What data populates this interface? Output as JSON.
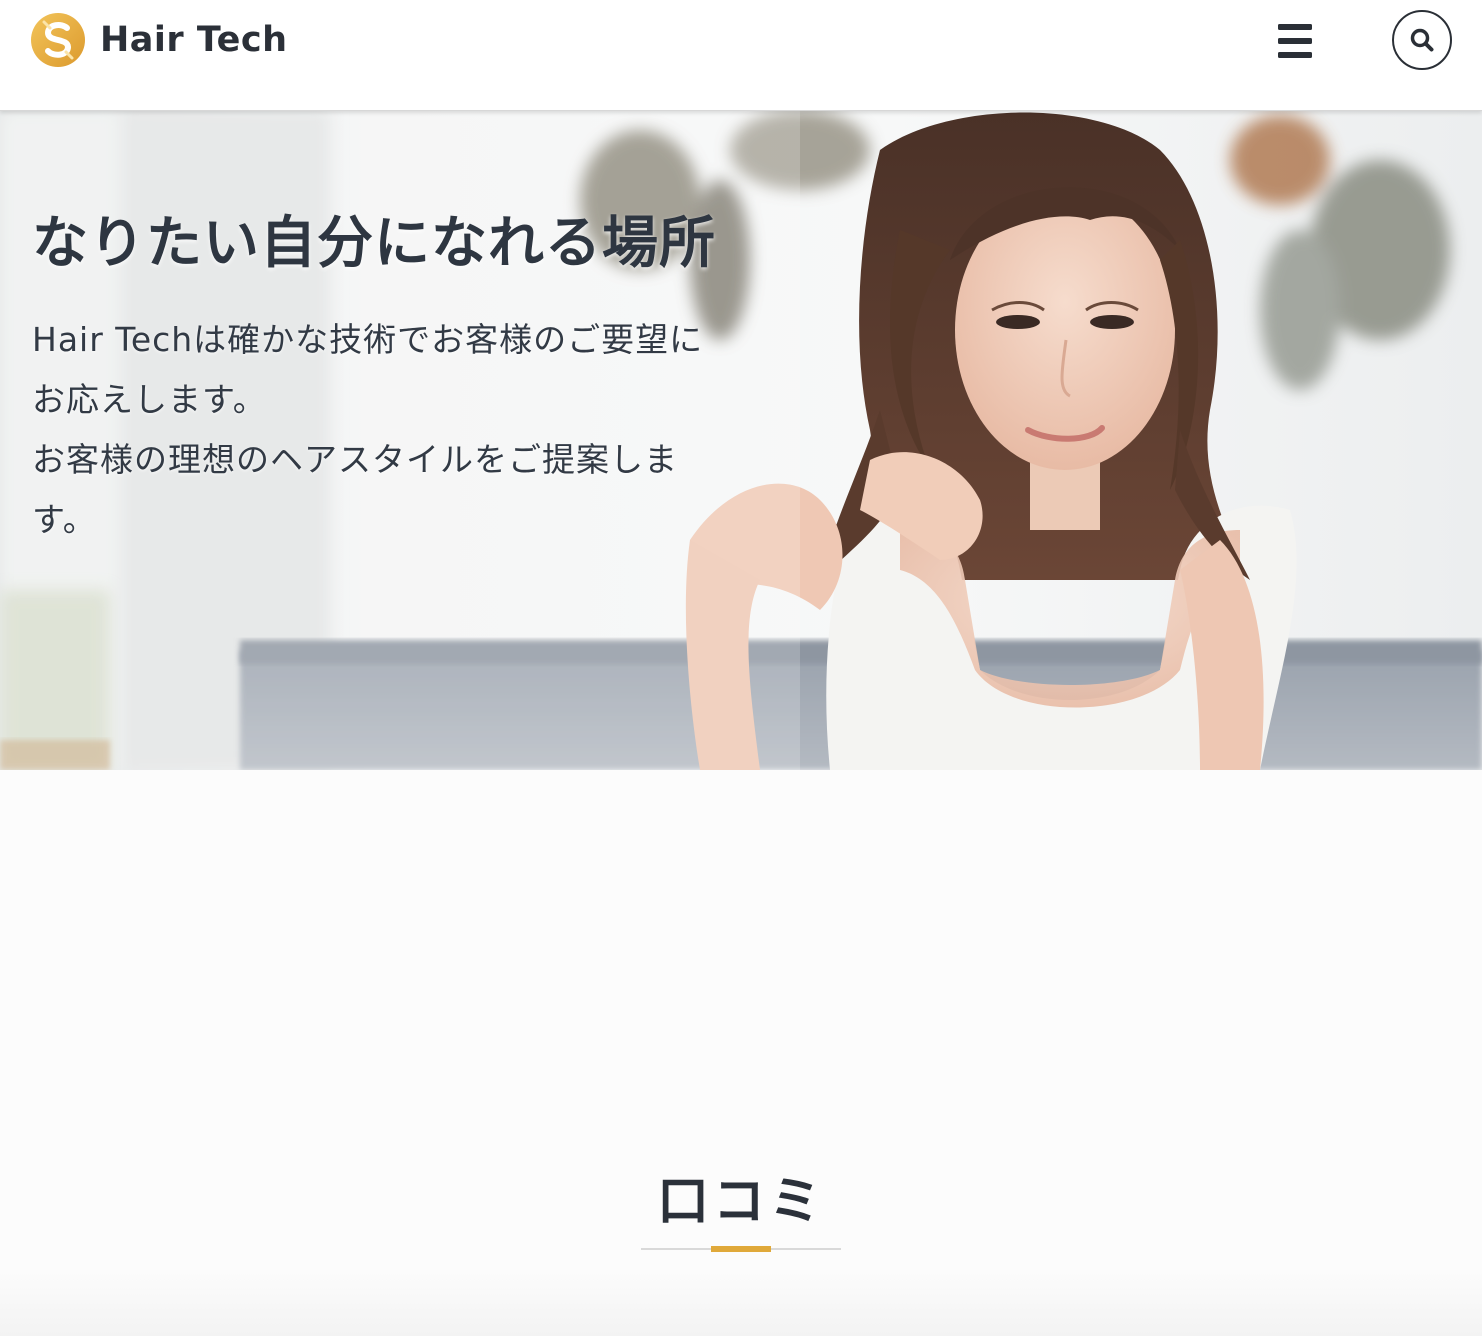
{
  "colors": {
    "accent": "#e0a93a",
    "text": "#2e3641",
    "header_bg": "#ffffff"
  },
  "header": {
    "logo_text": "Hair Tech",
    "logo_icon": "s-logo-icon",
    "menu_icon": "hamburger-menu-icon",
    "search_icon": "search-icon"
  },
  "hero": {
    "heading": "なりたい自分になれる場所",
    "lines": [
      "Hair Techは確かな技術でお客様のご要望に",
      "お応えします。",
      "お客様の理想のヘアスタイルをご提案しま",
      "す。"
    ]
  },
  "reviews": {
    "title": "口コミ"
  }
}
